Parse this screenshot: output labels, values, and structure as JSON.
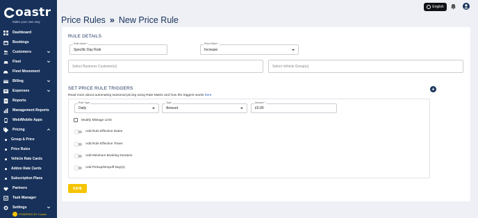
{
  "brand": {
    "name": "oastr",
    "tagline": "Make your own way",
    "powered_by": "POWERED BY Coastr"
  },
  "sidebar": {
    "items": [
      {
        "label": "Dashboard",
        "icon": "dashboard-icon",
        "chevron": false
      },
      {
        "label": "Bookings",
        "icon": "bookings-icon",
        "chevron": false
      },
      {
        "label": "Customers",
        "icon": "customers-icon",
        "chevron": true
      },
      {
        "label": "Fleet",
        "icon": "car-icon",
        "chevron": true
      },
      {
        "label": "Fleet Movement",
        "icon": "fleet-movement-icon",
        "chevron": false
      },
      {
        "label": "Billing",
        "icon": "billing-icon",
        "chevron": true
      },
      {
        "label": "Expenses",
        "icon": "expenses-icon",
        "chevron": true
      },
      {
        "label": "Reports",
        "icon": "reports-icon",
        "chevron": false
      },
      {
        "label": "Management Reports",
        "icon": "management-reports-icon",
        "chevron": false
      },
      {
        "label": "Web/Mobile Apps",
        "icon": "apps-icon",
        "chevron": false
      },
      {
        "label": "Pricing",
        "icon": "pricing-tag-icon",
        "chevron": true
      }
    ],
    "pricing_sub": [
      "Group & Price",
      "Price Rules",
      "Vehicle Rate Cards",
      "Addon Rate Cards",
      "Subscription Plans"
    ],
    "items_after": [
      {
        "label": "Partners",
        "icon": "partners-icon",
        "chevron": false
      },
      {
        "label": "Task Manager",
        "icon": "task-manager-icon",
        "chevron": false
      },
      {
        "label": "Settings",
        "icon": "gear-icon",
        "chevron": true
      }
    ]
  },
  "header": {
    "breadcrumb_root": "Price Rules",
    "breadcrumb_sep": "»",
    "breadcrumb_current": "New Price Rule",
    "language": "English"
  },
  "rule_details": {
    "title": "RULE DETAILS",
    "rule_name_label": "Rule Name *",
    "rule_name_value": "Specific Day Rule",
    "price_effect_label": "Price Effect *",
    "price_effect_value": "Increase",
    "business_customers_placeholder": "Select Business Customer(s)",
    "vehicle_groups_placeholder": "Select Vehicle Group(s)"
  },
  "triggers": {
    "title": "SET PRICE RULE TRIGGERS",
    "info_text": "Read more about automating seasonal pricing using Rate Matrix and how the triggers works ",
    "info_link": "here",
    "rule_type_label": "Rule Type",
    "rule_type_value": "Daily",
    "type_label": "Type",
    "type_value": "Amount",
    "amount_label": "Amount *",
    "amount_value": "£0.00",
    "modify_mileage": "Modify Mileage Limit",
    "toggles": [
      "Add Rule Effective Dates",
      "Add Rule Effective Times",
      "Add Minimum Booking Duration",
      "Add Pickup/Dropoff Day(s)"
    ]
  },
  "save_label": "SAVE",
  "colors": {
    "sidebar": "#17315a",
    "accent": "#f5c400",
    "title": "#17315a"
  }
}
